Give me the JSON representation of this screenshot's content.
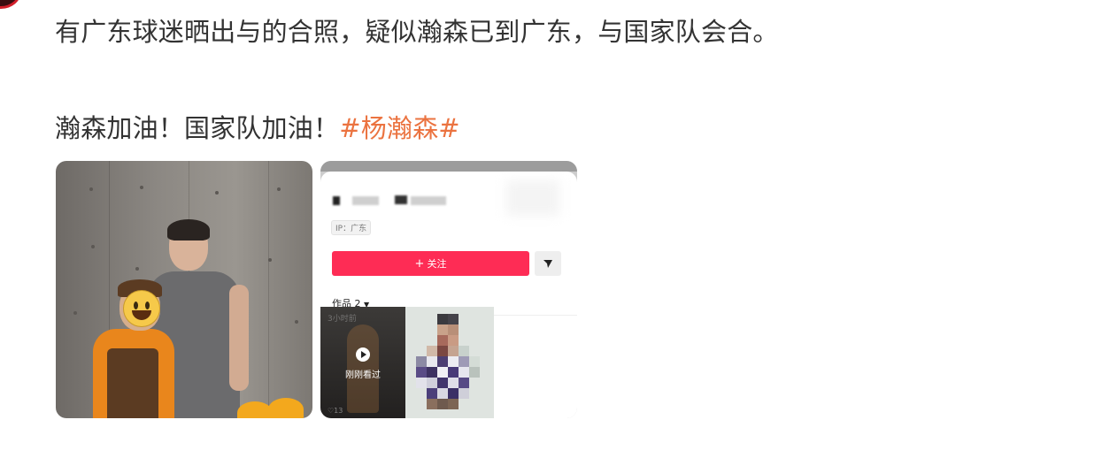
{
  "post": {
    "line1": "有广东球迷晒出与的合照，疑似瀚森已到广东，与国家队会合。",
    "line2_text": "瀚森加油！国家队加油！",
    "hashtag": "#杨瀚森#"
  },
  "colors": {
    "hashtag": "#eb7340",
    "follow_button": "#fe2c55",
    "text": "#333333"
  },
  "images": [
    {
      "kind": "photo",
      "icons": [
        "grinning-face-emoji-icon"
      ]
    },
    {
      "kind": "profile-screenshot",
      "ip_label": "IP：广东",
      "follow_label": "关注",
      "follow_icon": "plus-icon",
      "share_icon": "send-icon",
      "works_label": "作品 2",
      "works_icon": "caret-down-icon",
      "thumb_time": "3小时前",
      "thumb_watched": "刚刚看过",
      "thumb_likes": "13",
      "thumb_icons": [
        "play-icon",
        "heart-icon"
      ]
    }
  ]
}
